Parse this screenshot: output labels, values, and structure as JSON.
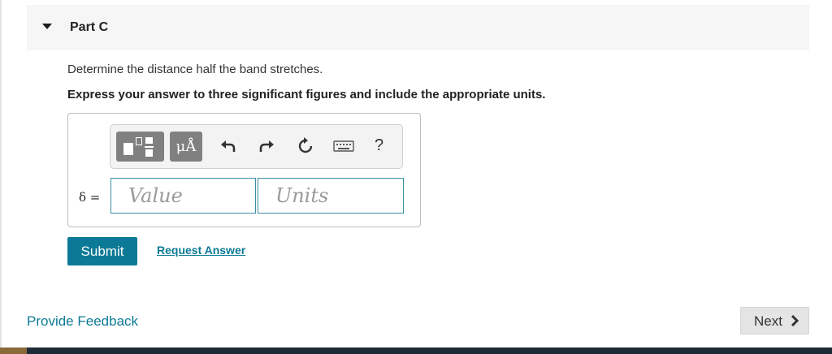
{
  "part": {
    "title": "Part C",
    "prompt": "Determine the distance half the band stretches.",
    "instruction": "Express your answer to three significant figures and include the appropriate units."
  },
  "toolbar": {
    "templates_icon": "templates-icon",
    "units_label": "μÅ",
    "undo_icon": "undo-icon",
    "redo_icon": "redo-icon",
    "reset_icon": "reset-icon",
    "keyboard_icon": "keyboard-icon",
    "help_label": "?"
  },
  "answer": {
    "variable_label": "δ =",
    "value_placeholder": "Value",
    "units_placeholder": "Units"
  },
  "actions": {
    "submit_label": "Submit",
    "request_answer_label": "Request Answer"
  },
  "footer": {
    "feedback_label": "Provide Feedback",
    "next_label": "Next"
  },
  "colors": {
    "accent": "#0c7a96",
    "header_bg": "#f6f6f6"
  }
}
